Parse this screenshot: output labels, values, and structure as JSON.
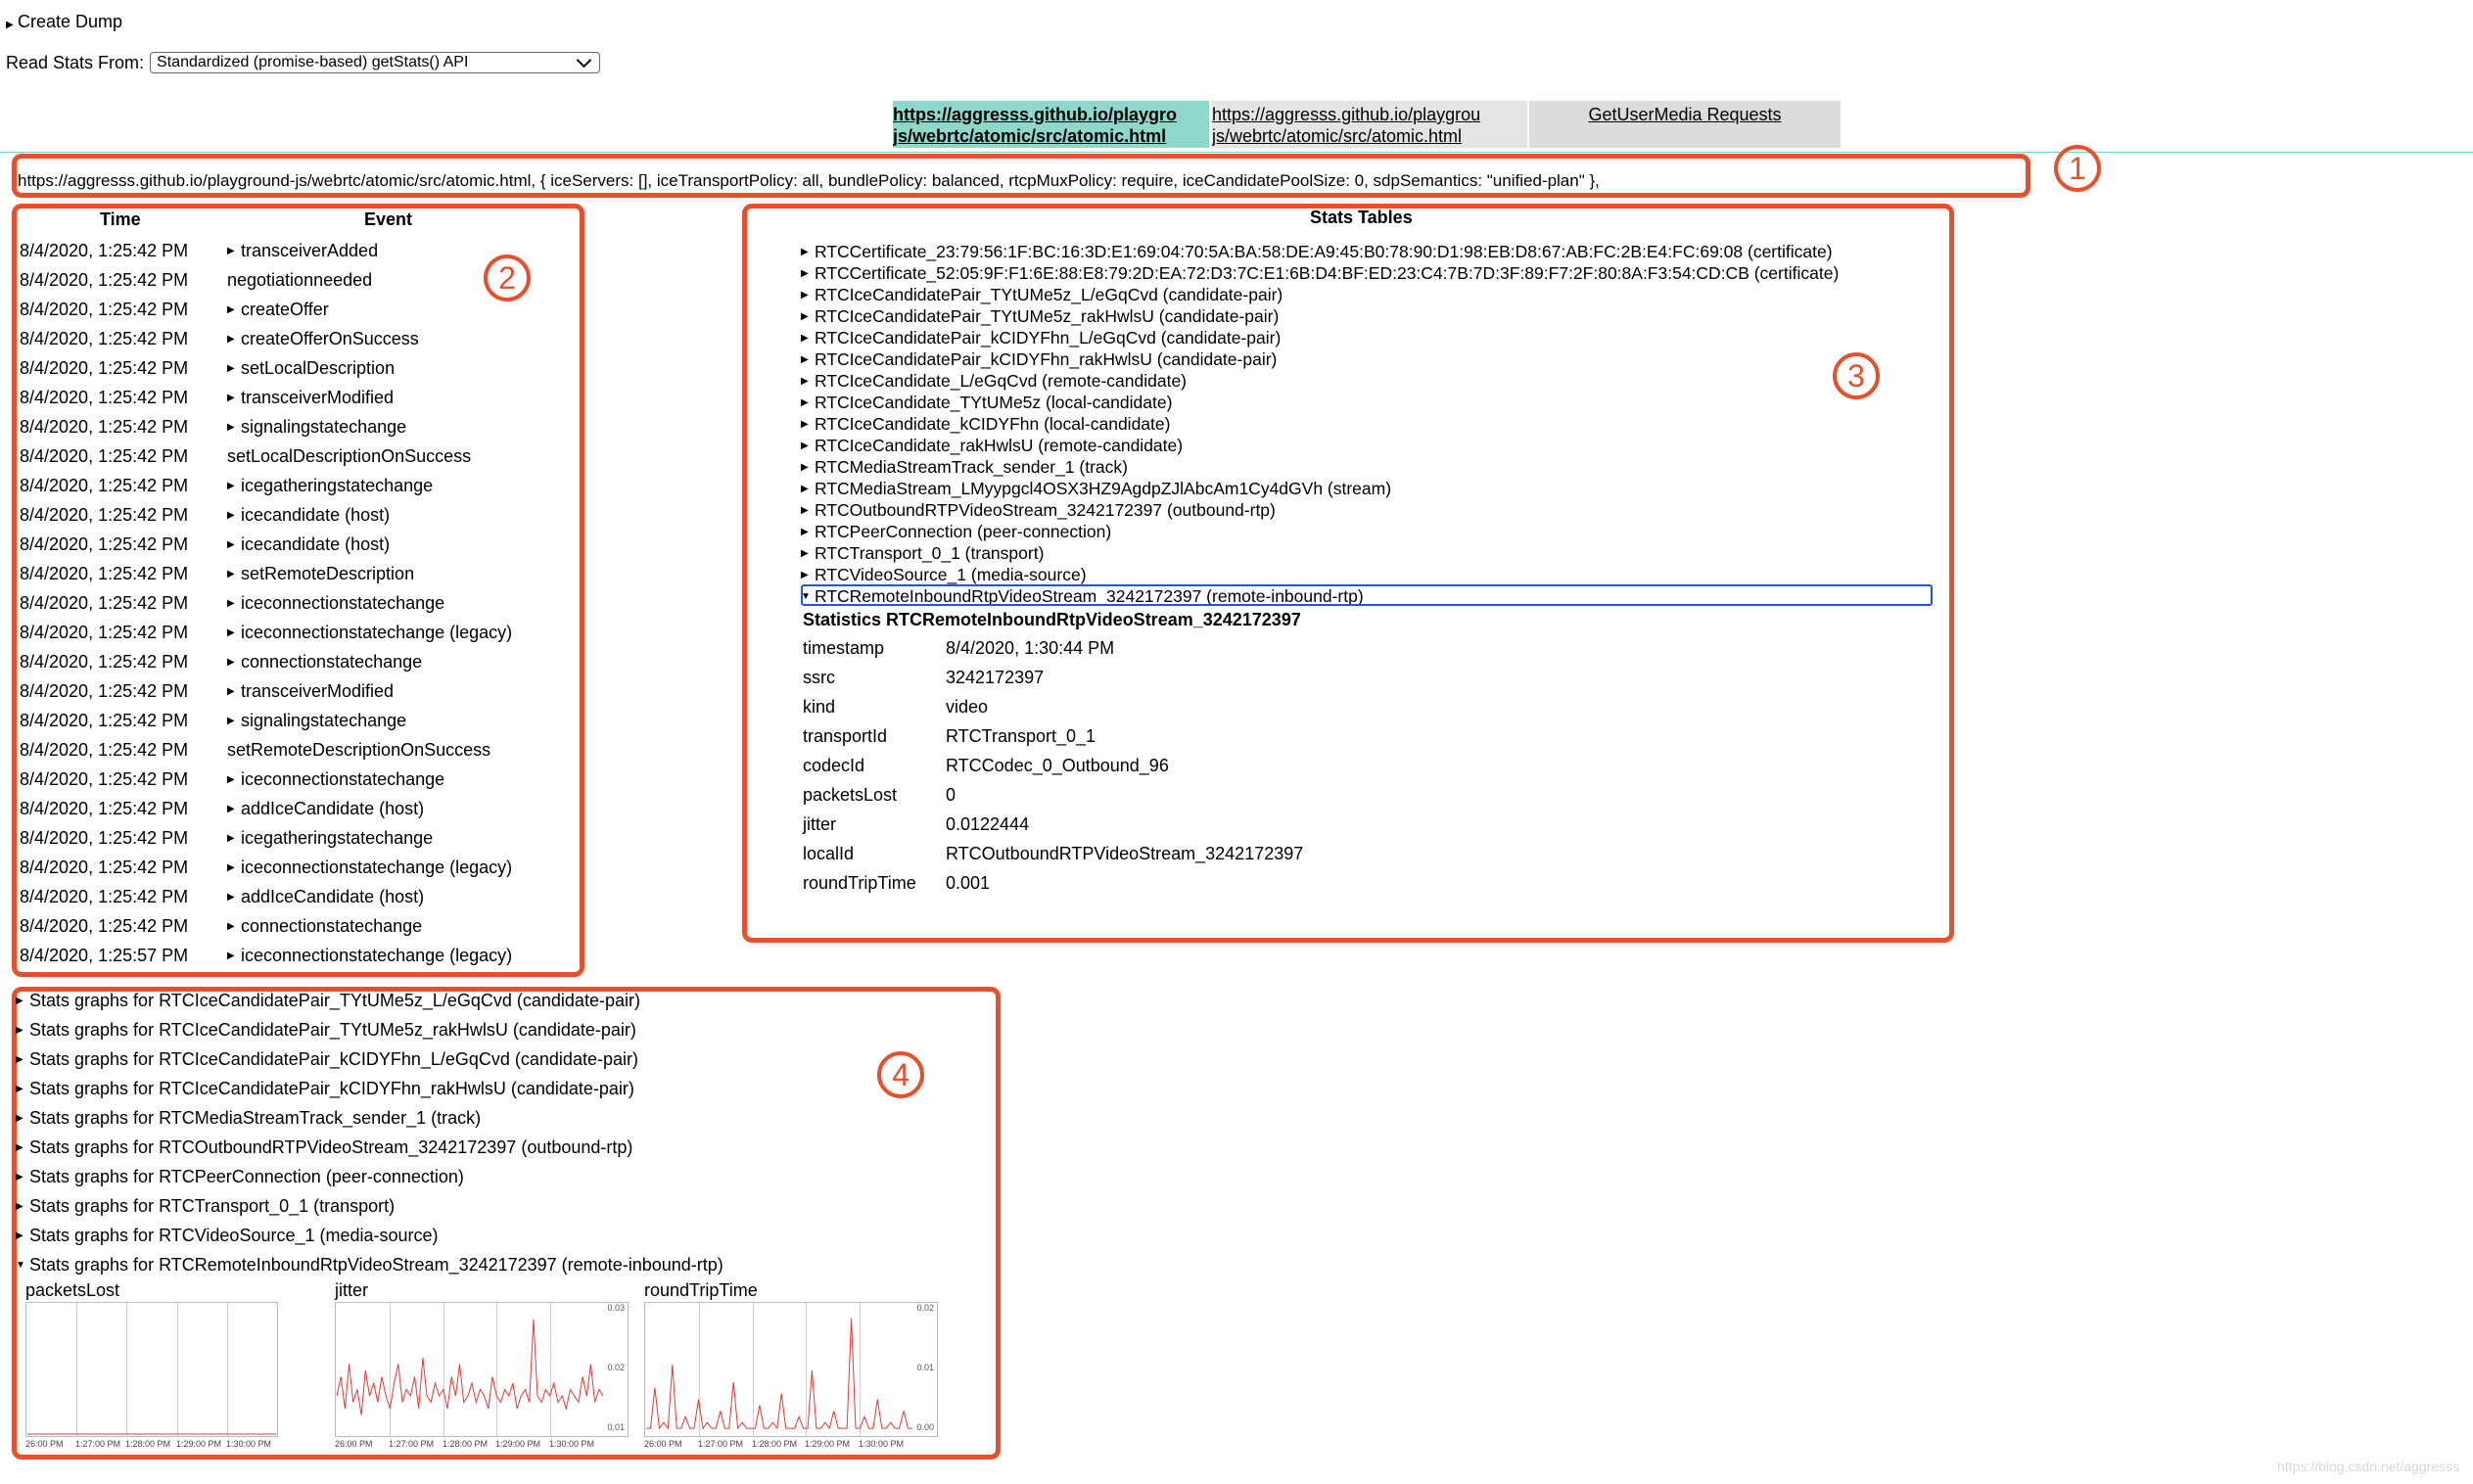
{
  "header": {
    "create_dump": "Create Dump",
    "read_stats_label": "Read Stats From:",
    "read_stats_selected": "Standardized (promise-based) getStats() API"
  },
  "tabs": [
    {
      "line1": "https://aggresss.github.io/playgro",
      "line2": "js/webrtc/atomic/src/atomic.html"
    },
    {
      "line1": "https://aggresss.github.io/playgrou",
      "line2": "js/webrtc/atomic/src/atomic.html"
    },
    {
      "line1": "GetUserMedia Requests"
    }
  ],
  "connection_info": "https://aggresss.github.io/playground-js/webrtc/atomic/src/atomic.html, { iceServers: [], iceTransportPolicy: all, bundlePolicy: balanced, rtcpMuxPolicy: require, iceCandidatePoolSize: 0, sdpSemantics: \"unified-plan\" },",
  "annotations": [
    "1",
    "2",
    "3",
    "4"
  ],
  "event_table": {
    "time_header": "Time",
    "event_header": "Event",
    "rows": [
      {
        "time": "8/4/2020, 1:25:42 PM",
        "event": "transceiverAdded",
        "expandable": true
      },
      {
        "time": "8/4/2020, 1:25:42 PM",
        "event": "negotiationneeded",
        "expandable": false
      },
      {
        "time": "8/4/2020, 1:25:42 PM",
        "event": "createOffer",
        "expandable": true
      },
      {
        "time": "8/4/2020, 1:25:42 PM",
        "event": "createOfferOnSuccess",
        "expandable": true
      },
      {
        "time": "8/4/2020, 1:25:42 PM",
        "event": "setLocalDescription",
        "expandable": true
      },
      {
        "time": "8/4/2020, 1:25:42 PM",
        "event": "transceiverModified",
        "expandable": true
      },
      {
        "time": "8/4/2020, 1:25:42 PM",
        "event": "signalingstatechange",
        "expandable": true
      },
      {
        "time": "8/4/2020, 1:25:42 PM",
        "event": "setLocalDescriptionOnSuccess",
        "expandable": false
      },
      {
        "time": "8/4/2020, 1:25:42 PM",
        "event": "icegatheringstatechange",
        "expandable": true
      },
      {
        "time": "8/4/2020, 1:25:42 PM",
        "event": "icecandidate (host)",
        "expandable": true
      },
      {
        "time": "8/4/2020, 1:25:42 PM",
        "event": "icecandidate (host)",
        "expandable": true
      },
      {
        "time": "8/4/2020, 1:25:42 PM",
        "event": "setRemoteDescription",
        "expandable": true
      },
      {
        "time": "8/4/2020, 1:25:42 PM",
        "event": "iceconnectionstatechange",
        "expandable": true
      },
      {
        "time": "8/4/2020, 1:25:42 PM",
        "event": "iceconnectionstatechange (legacy)",
        "expandable": true
      },
      {
        "time": "8/4/2020, 1:25:42 PM",
        "event": "connectionstatechange",
        "expandable": true
      },
      {
        "time": "8/4/2020, 1:25:42 PM",
        "event": "transceiverModified",
        "expandable": true
      },
      {
        "time": "8/4/2020, 1:25:42 PM",
        "event": "signalingstatechange",
        "expandable": true
      },
      {
        "time": "8/4/2020, 1:25:42 PM",
        "event": "setRemoteDescriptionOnSuccess",
        "expandable": false
      },
      {
        "time": "8/4/2020, 1:25:42 PM",
        "event": "iceconnectionstatechange",
        "expandable": true
      },
      {
        "time": "8/4/2020, 1:25:42 PM",
        "event": "addIceCandidate (host)",
        "expandable": true
      },
      {
        "time": "8/4/2020, 1:25:42 PM",
        "event": "icegatheringstatechange",
        "expandable": true
      },
      {
        "time": "8/4/2020, 1:25:42 PM",
        "event": "iceconnectionstatechange (legacy)",
        "expandable": true
      },
      {
        "time": "8/4/2020, 1:25:42 PM",
        "event": "addIceCandidate (host)",
        "expandable": true
      },
      {
        "time": "8/4/2020, 1:25:42 PM",
        "event": "connectionstatechange",
        "expandable": true
      },
      {
        "time": "8/4/2020, 1:25:57 PM",
        "event": "iceconnectionstatechange (legacy)",
        "expandable": true
      }
    ]
  },
  "stats_tables": {
    "title": "Stats Tables",
    "items": [
      "RTCCertificate_23:79:56:1F:BC:16:3D:E1:69:04:70:5A:BA:58:DE:A9:45:B0:78:90:D1:98:EB:D8:67:AB:FC:2B:E4:FC:69:08 (certificate)",
      "RTCCertificate_52:05:9F:F1:6E:88:E8:79:2D:EA:72:D3:7C:E1:6B:D4:BF:ED:23:C4:7B:7D:3F:89:F7:2F:80:8A:F3:54:CD:CB (certificate)",
      "RTCIceCandidatePair_TYtUMe5z_L/eGqCvd (candidate-pair)",
      "RTCIceCandidatePair_TYtUMe5z_rakHwlsU (candidate-pair)",
      "RTCIceCandidatePair_kCIDYFhn_L/eGqCvd (candidate-pair)",
      "RTCIceCandidatePair_kCIDYFhn_rakHwlsU (candidate-pair)",
      "RTCIceCandidate_L/eGqCvd (remote-candidate)",
      "RTCIceCandidate_TYtUMe5z (local-candidate)",
      "RTCIceCandidate_kCIDYFhn (local-candidate)",
      "RTCIceCandidate_rakHwlsU (remote-candidate)",
      "RTCMediaStreamTrack_sender_1 (track)",
      "RTCMediaStream_LMyypgcl4OSX3HZ9AgdpZJlAbcAm1Cy4dGVh (stream)",
      "RTCOutboundRTPVideoStream_3242172397 (outbound-rtp)",
      "RTCPeerConnection (peer-connection)",
      "RTCTransport_0_1 (transport)",
      "RTCVideoSource_1 (media-source)",
      "RTCRemoteInboundRtpVideoStream_3242172397 (remote-inbound-rtp)"
    ],
    "selected_title": "Statistics RTCRemoteInboundRtpVideoStream_3242172397",
    "selected_stats": [
      {
        "key": "timestamp",
        "value": "8/4/2020, 1:30:44 PM"
      },
      {
        "key": "ssrc",
        "value": "3242172397"
      },
      {
        "key": "kind",
        "value": "video"
      },
      {
        "key": "transportId",
        "value": "RTCTransport_0_1"
      },
      {
        "key": "codecId",
        "value": "RTCCodec_0_Outbound_96"
      },
      {
        "key": "packetsLost",
        "value": "0"
      },
      {
        "key": "jitter",
        "value": "0.0122444"
      },
      {
        "key": "localId",
        "value": "RTCOutboundRTPVideoStream_3242172397"
      },
      {
        "key": "roundTripTime",
        "value": "0.001"
      }
    ]
  },
  "stats_graphs": {
    "items": [
      {
        "label": "Stats graphs for RTCIceCandidatePair_TYtUMe5z_L/eGqCvd (candidate-pair)",
        "expanded": false
      },
      {
        "label": "Stats graphs for RTCIceCandidatePair_TYtUMe5z_rakHwlsU (candidate-pair)",
        "expanded": false
      },
      {
        "label": "Stats graphs for RTCIceCandidatePair_kCIDYFhn_L/eGqCvd (candidate-pair)",
        "expanded": false
      },
      {
        "label": "Stats graphs for RTCIceCandidatePair_kCIDYFhn_rakHwlsU (candidate-pair)",
        "expanded": false
      },
      {
        "label": "Stats graphs for RTCMediaStreamTrack_sender_1 (track)",
        "expanded": false
      },
      {
        "label": "Stats graphs for RTCOutboundRTPVideoStream_3242172397 (outbound-rtp)",
        "expanded": false
      },
      {
        "label": "Stats graphs for RTCPeerConnection (peer-connection)",
        "expanded": false
      },
      {
        "label": "Stats graphs for RTCTransport_0_1 (transport)",
        "expanded": false
      },
      {
        "label": "Stats graphs for RTCVideoSource_1 (media-source)",
        "expanded": false
      },
      {
        "label": "Stats graphs for RTCRemoteInboundRtpVideoStream_3242172397 (remote-inbound-rtp)",
        "expanded": true
      }
    ],
    "x_ticks": [
      "26:00 PM",
      "1:27:00 PM",
      "1:28:00 PM",
      "1:29:00 PM",
      "1:30:00 PM"
    ],
    "line_color": "#e53935"
  },
  "chart_data": [
    {
      "type": "line",
      "title": "packetsLost",
      "x": [
        "26:00 PM",
        "1:27:00 PM",
        "1:28:00 PM",
        "1:29:00 PM",
        "1:30:00 PM"
      ],
      "series": [
        {
          "values": [
            0,
            0,
            0,
            0,
            0
          ]
        }
      ],
      "y_ticks": [],
      "ylim": [
        0,
        1
      ]
    },
    {
      "type": "line",
      "title": "jitter",
      "x": [
        "26:00 PM",
        "1:27:00 PM",
        "1:28:00 PM",
        "1:29:00 PM",
        "1:30:00 PM"
      ],
      "series": [
        {
          "values": [
            0.016,
            0.019,
            0.014,
            0.021,
            0.015,
            0.017,
            0.013,
            0.02,
            0.016,
            0.018,
            0.015,
            0.019,
            0.016,
            0.014,
            0.018,
            0.021,
            0.015,
            0.017,
            0.016,
            0.019,
            0.014,
            0.022,
            0.016,
            0.015,
            0.018,
            0.016,
            0.017,
            0.014,
            0.019,
            0.016,
            0.021,
            0.015,
            0.016,
            0.018,
            0.015,
            0.017,
            0.016,
            0.014,
            0.019,
            0.016,
            0.015,
            0.017,
            0.016,
            0.018,
            0.014,
            0.016,
            0.017,
            0.015,
            0.028,
            0.016,
            0.015,
            0.017,
            0.016,
            0.018,
            0.015,
            0.016,
            0.014,
            0.017,
            0.016,
            0.015,
            0.019,
            0.016,
            0.021,
            0.015,
            0.017,
            0.016
          ]
        }
      ],
      "y_ticks": [
        "0.03",
        "0.02",
        "0.01"
      ],
      "ylim": [
        0.01,
        0.03
      ]
    },
    {
      "type": "line",
      "title": "roundTripTime",
      "x": [
        "26:00 PM",
        "1:27:00 PM",
        "1:28:00 PM",
        "1:29:00 PM",
        "1:30:00 PM"
      ],
      "series": [
        {
          "values": [
            0.001,
            0.001,
            0.008,
            0.001,
            0.002,
            0.001,
            0.012,
            0.001,
            0.001,
            0.003,
            0.001,
            0.001,
            0.006,
            0.001,
            0.002,
            0.001,
            0.001,
            0.004,
            0.001,
            0.001,
            0.009,
            0.001,
            0.002,
            0.001,
            0.001,
            0.001,
            0.005,
            0.001,
            0.001,
            0.002,
            0.001,
            0.007,
            0.001,
            0.001,
            0.001,
            0.003,
            0.001,
            0.001,
            0.011,
            0.001,
            0.001,
            0.002,
            0.001,
            0.004,
            0.001,
            0.001,
            0.001,
            0.02,
            0.001,
            0.001,
            0.003,
            0.001,
            0.001,
            0.006,
            0.001,
            0.001,
            0.002,
            0.001,
            0.001,
            0.004,
            0.001,
            0.001
          ]
        }
      ],
      "y_ticks": [
        "0.02",
        "0.01",
        "0.00"
      ],
      "ylim": [
        0,
        0.022
      ]
    }
  ],
  "watermark": "https://blog.csdn.net/aggresss"
}
